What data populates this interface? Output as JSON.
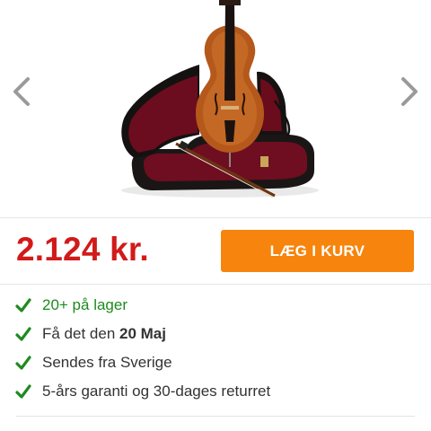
{
  "product": {
    "image_alt": "Cello with open hard case and bow",
    "price": "2.124 kr.",
    "add_to_cart_label": "LÆG I KURV"
  },
  "gallery": {
    "prev_icon": "chevron-left-icon",
    "next_icon": "chevron-right-icon"
  },
  "usps": [
    {
      "icon": "check-icon",
      "text": "20+ på lager"
    },
    {
      "icon": "check-icon",
      "prefix": "Få det den ",
      "bold": "20 Maj"
    },
    {
      "icon": "check-icon",
      "text": "Sendes fra Sverige"
    },
    {
      "icon": "check-icon",
      "text": "5-års garanti og 30-dages returret"
    }
  ],
  "colors": {
    "price": "#d21a1a",
    "cart_button": "#f7840c",
    "check": "#1e8b1e",
    "in_stock": "#1e8b1e"
  }
}
